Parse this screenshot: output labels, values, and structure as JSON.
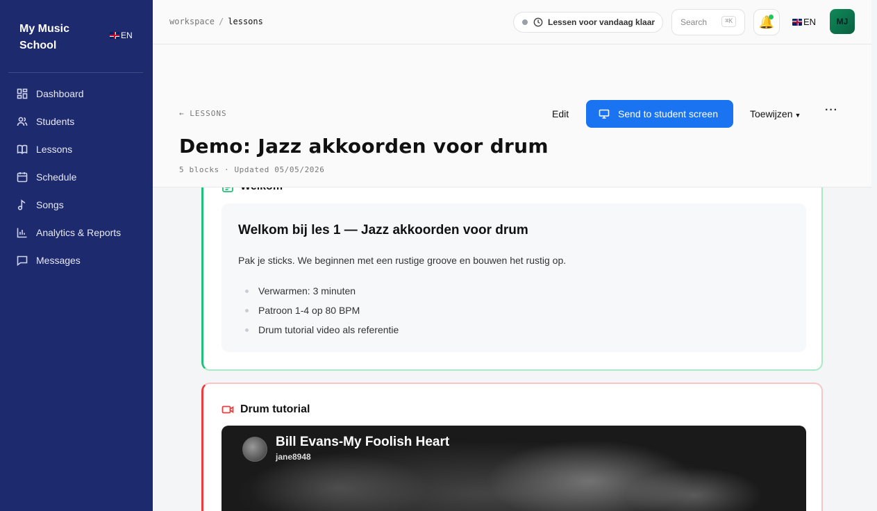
{
  "sidebar": {
    "brand": "My Music School",
    "lang": "EN",
    "items": [
      {
        "label": "Dashboard",
        "icon": "dashboard-icon"
      },
      {
        "label": "Students",
        "icon": "users-icon"
      },
      {
        "label": "Lessons",
        "icon": "book-icon"
      },
      {
        "label": "Schedule",
        "icon": "calendar-icon"
      },
      {
        "label": "Songs",
        "icon": "music-note-icon"
      },
      {
        "label": "Analytics & Reports",
        "icon": "bar-chart-icon"
      },
      {
        "label": "Messages",
        "icon": "message-icon"
      }
    ]
  },
  "header": {
    "breadcrumb": [
      "workspace",
      "lessons"
    ],
    "status": "Lessen voor vandaag klaar",
    "search_placeholder": "Search",
    "search_shortcut": "⌘K",
    "lang": "EN",
    "avatar_initials": "MJ"
  },
  "lesson": {
    "back_label": "← LESSONS",
    "edit_label": "Edit",
    "send_label": "Send to student screen",
    "assign_label": "Toewijzen",
    "more_label": "···",
    "title": "Demo: Jazz akkoorden voor drum",
    "meta": "5 blocks · Updated 05/05/2026"
  },
  "blocks": {
    "welcome": {
      "label": "Welkom",
      "heading": "Welkom bij les 1 — Jazz akkoorden voor drum",
      "intro": "Pak je sticks. We beginnen met een rustige groove en bouwen het rustig op.",
      "bullets": [
        "Verwarmen: 3 minuten",
        "Patroon 1-4 op 80 BPM",
        "Drum tutorial video als referentie"
      ]
    },
    "video": {
      "label": "Drum tutorial",
      "video_title": "Bill Evans-My Foolish Heart",
      "channel": "jane8948"
    }
  },
  "colors": {
    "sidebar_bg": "#1e2a6e",
    "accent_blue": "#1a73f0",
    "block_green": "#22c07a",
    "block_red": "#ee3b3b"
  }
}
